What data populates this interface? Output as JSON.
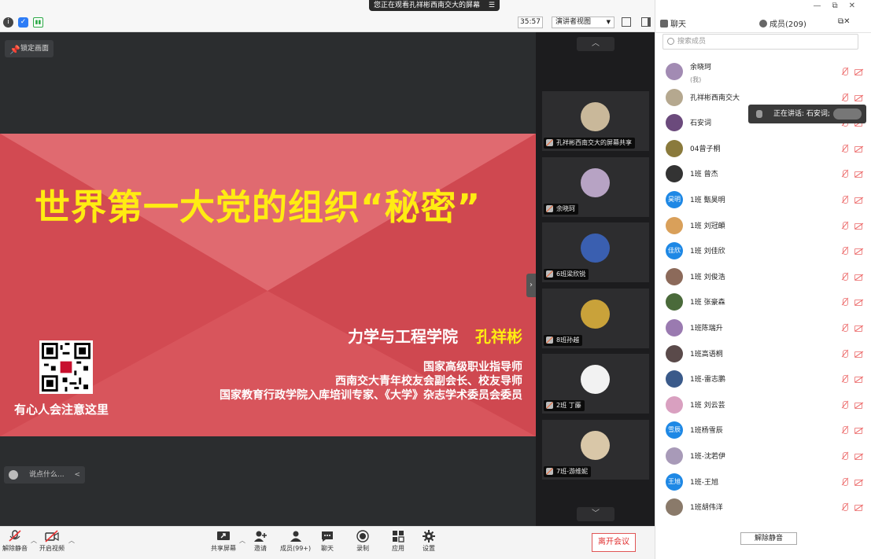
{
  "top": {
    "screen_banner": "您正在观看孔祥彬西南交大的屏幕",
    "banner_menu": "☰",
    "timer": "35:57",
    "view_mode": "演讲者视图"
  },
  "share": {
    "lock_label": "锁定画面",
    "slide_title": "世界第一大党的组织“秘密”",
    "author_school": "力学与工程学院",
    "author_name": "孔祥彬",
    "lines": [
      "国家高级职业指导师",
      "西南交大青年校友会副会长、校友导师",
      "国家教育行政学院入库培训专家、《大学》杂志学术委员会委员"
    ],
    "qr_caption": "有心人会注意这里",
    "chat_placeholder": "说点什么...",
    "chat_arrow": "<",
    "collapse": "›"
  },
  "thumbs": {
    "up": "︿",
    "down": "﹀",
    "items": [
      {
        "label": "孔祥彬西南交大的屏幕共享",
        "color": "#c9b89a"
      },
      {
        "label": "余晓珂",
        "color": "#b7a3c4"
      },
      {
        "label": "6班梁欣锐",
        "color": "#3a5fb0"
      },
      {
        "label": "8班孙越",
        "color": "#c9a23a"
      },
      {
        "label": "2班 丁藤",
        "color": "#f2f2f2"
      },
      {
        "label": "7班-游维妮",
        "color": "#d9c7a8"
      }
    ]
  },
  "toolbar": {
    "unmute": "解除静音",
    "video": "开启视频",
    "share": "共享屏幕",
    "invite": "邀请",
    "members": "成员(99+)",
    "chat": "聊天",
    "record": "录制",
    "apps": "应用",
    "settings": "设置",
    "leave": "离开会议"
  },
  "panel": {
    "tab_chat": "聊天",
    "tab_members": "成员(209)",
    "window_controls": "⧉✕",
    "search_placeholder": "搜索成员",
    "speaking_tip": "正在讲话: 石安词;",
    "unmute_all": "解除静音",
    "members": [
      {
        "name": "余晓珂",
        "sub": "(我)",
        "avatar_text": "",
        "color": "#a28bb3"
      },
      {
        "name": "孔祥彬西南交大",
        "sub": "",
        "avatar_text": "",
        "color": "#b5a88f"
      },
      {
        "name": "石安词",
        "sub": "",
        "avatar_text": "",
        "color": "#6b4a7c"
      },
      {
        "name": "04曾子桐",
        "sub": "",
        "avatar_text": "",
        "color": "#8a7a3c"
      },
      {
        "name": "1班 曾杰",
        "sub": "",
        "avatar_text": "",
        "color": "#333333"
      },
      {
        "name": "1班 甄昊明",
        "sub": "",
        "avatar_text": "昊明",
        "color": "#1e88e5"
      },
      {
        "name": "1班 刘冠頔",
        "sub": "",
        "avatar_text": "",
        "color": "#d9a05a"
      },
      {
        "name": "1班 刘佳欣",
        "sub": "",
        "avatar_text": "佳欣",
        "color": "#1e88e5"
      },
      {
        "name": "1班 刘俊浩",
        "sub": "",
        "avatar_text": "",
        "color": "#8c6a5a"
      },
      {
        "name": "1班 张豪森",
        "sub": "",
        "avatar_text": "",
        "color": "#4a6a3a"
      },
      {
        "name": "1班陈瑞升",
        "sub": "",
        "avatar_text": "",
        "color": "#9a7ab0"
      },
      {
        "name": "1班高语桐",
        "sub": "",
        "avatar_text": "",
        "color": "#5a4a4a"
      },
      {
        "name": "1班-雷志鹏",
        "sub": "",
        "avatar_text": "",
        "color": "#3a5a8a"
      },
      {
        "name": "1班 刘云芸",
        "sub": "",
        "avatar_text": "",
        "color": "#d9a0c0"
      },
      {
        "name": "1班杨雪辰",
        "sub": "",
        "avatar_text": "雪辰",
        "color": "#1e88e5"
      },
      {
        "name": "1班-沈若伊",
        "sub": "",
        "avatar_text": "",
        "color": "#a89ab8"
      },
      {
        "name": "1班-王旭",
        "sub": "",
        "avatar_text": "王旭",
        "color": "#1e88e5"
      },
      {
        "name": "1班胡伟洋",
        "sub": "",
        "avatar_text": "",
        "color": "#8a7a6a"
      }
    ]
  }
}
